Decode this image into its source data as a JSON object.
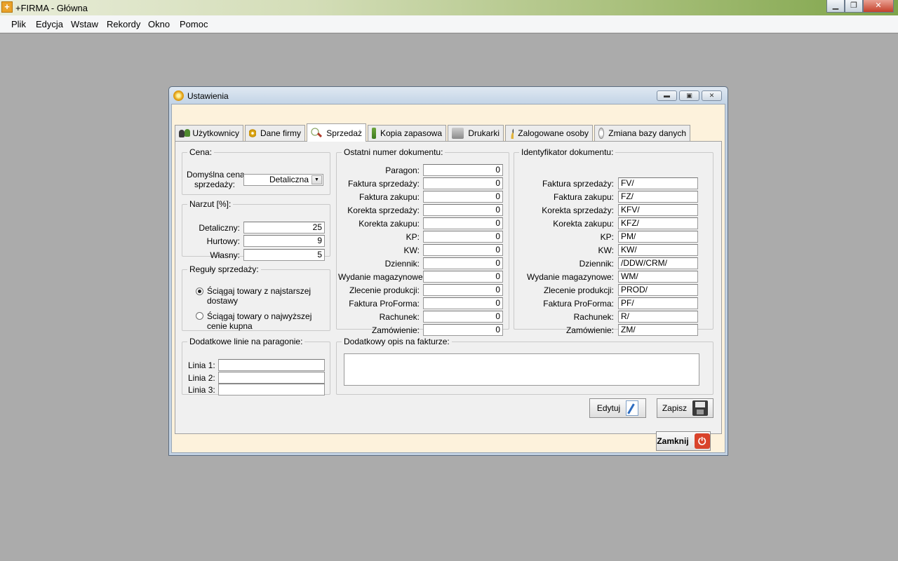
{
  "app": {
    "title": "+FIRMA - Główna"
  },
  "window_controls": {
    "minimize": "▁",
    "maximize": "❐",
    "close": "✕"
  },
  "menu": [
    {
      "label": "Plik"
    },
    {
      "label": "Edycja"
    },
    {
      "label": "Wstaw"
    },
    {
      "label": "Rekordy"
    },
    {
      "label": "Okno"
    },
    {
      "label": "Pomoc"
    }
  ],
  "dialog": {
    "title": "Ustawienia",
    "controls": {
      "minimize": "▬",
      "maximize": "▣",
      "close": "✕"
    },
    "tabs": [
      {
        "label": "Użytkownicy",
        "icon": "users-icon"
      },
      {
        "label": "Dane firmy",
        "icon": "gear-icon"
      },
      {
        "label": "Sprzedaż",
        "icon": "sales-icon",
        "active": true
      },
      {
        "label": "Kopia zapasowa",
        "icon": "backup-icon"
      },
      {
        "label": "Drukarki",
        "icon": "printer-icon"
      },
      {
        "label": "Zalogowane osoby",
        "icon": "logged-user-icon"
      },
      {
        "label": "Zmiana bazy danych",
        "icon": "database-disc-icon"
      }
    ],
    "price": {
      "legend": "Cena:",
      "label_line1": "Domyślna cena",
      "label_line2": "sprzedaży:",
      "selected": "Detaliczna",
      "dropdown_glyph": "▼"
    },
    "markup": {
      "legend": "Narzut [%]:",
      "rows": [
        {
          "label": "Detaliczny:",
          "value": "25"
        },
        {
          "label": "Hurtowy:",
          "value": "9"
        },
        {
          "label": "Własny:",
          "value": "5"
        }
      ]
    },
    "rules": {
      "legend": "Reguły sprzedaży:",
      "options": [
        {
          "line1": "Ściągaj towary z najstarszej",
          "line2": "dostawy",
          "checked": true
        },
        {
          "line1": "Ściągaj towary o najwyższej",
          "line2": "cenie kupna",
          "checked": false
        }
      ]
    },
    "receipt_lines": {
      "legend": "Dodatkowe linie na paragonie:",
      "rows": [
        {
          "label": "Linia 1:",
          "value": ""
        },
        {
          "label": "Linia 2:",
          "value": ""
        },
        {
          "label": "Linia 3:",
          "value": ""
        }
      ]
    },
    "last_numbers": {
      "legend": "Ostatni numer dokumentu:",
      "rows": [
        {
          "label": "Paragon:",
          "value": "0"
        },
        {
          "label": "Faktura sprzedaży:",
          "value": "0"
        },
        {
          "label": "Faktura zakupu:",
          "value": "0"
        },
        {
          "label": "Korekta sprzedaży:",
          "value": "0"
        },
        {
          "label": "Korekta zakupu:",
          "value": "0"
        },
        {
          "label": "KP:",
          "value": "0"
        },
        {
          "label": "KW:",
          "value": "0"
        },
        {
          "label": "Dziennik:",
          "value": "0"
        },
        {
          "label": "Wydanie magazynowe:",
          "value": "0"
        },
        {
          "label": "Zlecenie produkcji:",
          "value": "0"
        },
        {
          "label": "Faktura ProForma:",
          "value": "0"
        },
        {
          "label": "Rachunek:",
          "value": "0"
        },
        {
          "label": "Zamówienie:",
          "value": "0"
        }
      ]
    },
    "identifiers": {
      "legend": "Identyfikator dokumentu:",
      "rows": [
        {
          "label": "Faktura sprzedaży:",
          "value": "FV/"
        },
        {
          "label": "Faktura zakupu:",
          "value": "FZ/"
        },
        {
          "label": "Korekta sprzedaży:",
          "value": "KFV/"
        },
        {
          "label": "Korekta zakupu:",
          "value": "KFZ/"
        },
        {
          "label": "KP:",
          "value": "PM/"
        },
        {
          "label": "KW:",
          "value": "KW/"
        },
        {
          "label": "Dziennik:",
          "value": "/DDW/CRM/"
        },
        {
          "label": "Wydanie magazynowe:",
          "value": "WM/"
        },
        {
          "label": "Zlecenie produkcji:",
          "value": "PROD/"
        },
        {
          "label": "Faktura ProForma:",
          "value": "PF/"
        },
        {
          "label": "Rachunek:",
          "value": "R/"
        },
        {
          "label": "Zamówienie:",
          "value": "ZM/"
        }
      ]
    },
    "invoice_desc": {
      "legend": "Dodatkowy opis na fakturze:",
      "value": ""
    },
    "buttons": {
      "edit": "Edytuj",
      "save": "Zapisz",
      "close": "Zamknij",
      "close_glyph": "⏻"
    }
  }
}
